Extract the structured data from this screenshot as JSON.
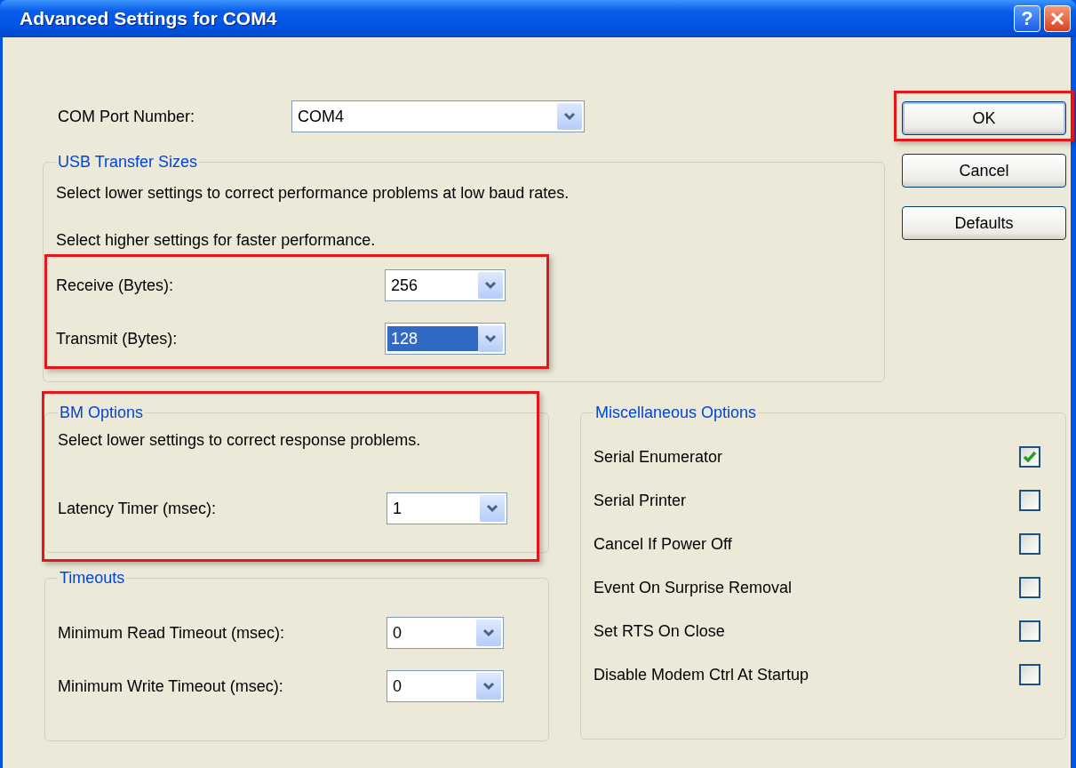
{
  "window": {
    "title": "Advanced Settings for COM4",
    "title_buttons": [
      {
        "kind": "help",
        "label": "?"
      },
      {
        "kind": "close"
      }
    ]
  },
  "com_port": {
    "label": "COM Port Number:",
    "value": "COM4"
  },
  "usb": {
    "title": "USB Transfer Sizes",
    "notes": [
      "Select lower settings to correct performance problems at low baud rates.",
      "Select higher settings for faster performance."
    ],
    "highlighted": true,
    "fields": [
      {
        "label": "Receive (Bytes):",
        "value": "256",
        "focused": false
      },
      {
        "label": "Transmit (Bytes):",
        "value": "128",
        "focused": true
      }
    ]
  },
  "bm": {
    "title": "BM Options",
    "note": "Select lower settings to correct response problems.",
    "highlighted": true,
    "fields": [
      {
        "label": "Latency Timer (msec):",
        "value": "1",
        "focused": false
      }
    ]
  },
  "timeouts": {
    "title": "Timeouts",
    "fields": [
      {
        "label": "Minimum Read Timeout (msec):",
        "value": "0",
        "focused": false
      },
      {
        "label": "Minimum Write Timeout (msec):",
        "value": "0",
        "focused": false
      }
    ]
  },
  "misc": {
    "title": "Miscellaneous Options",
    "options": [
      {
        "label": "Serial Enumerator",
        "checked": true
      },
      {
        "label": "Serial Printer",
        "checked": false
      },
      {
        "label": "Cancel If Power Off",
        "checked": false
      },
      {
        "label": "Event On Surprise Removal",
        "checked": false
      },
      {
        "label": "Set RTS On Close",
        "checked": false
      },
      {
        "label": "Disable Modem Ctrl At Startup",
        "checked": false
      }
    ]
  },
  "buttons": [
    {
      "label": "OK",
      "highlighted": true
    },
    {
      "label": "Cancel",
      "highlighted": false
    },
    {
      "label": "Defaults",
      "highlighted": false
    }
  ]
}
